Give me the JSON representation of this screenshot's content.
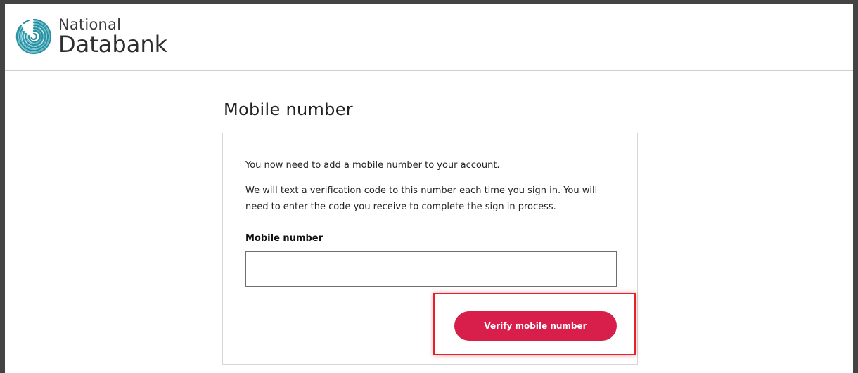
{
  "brand": {
    "line1": "National",
    "line2": "Databank",
    "logo_icon": "fingerprint-icon"
  },
  "page": {
    "title": "Mobile number"
  },
  "card": {
    "intro": "You now need to add a mobile number to your account.",
    "details": "We will text a verification code to this number each time you sign in. You will need to enter the code you receive to complete the sign in process.",
    "field_label": "Mobile number",
    "field_value": "",
    "field_placeholder": "",
    "button_label": "Verify mobile number"
  },
  "colors": {
    "frame": "#434343",
    "brand_teal": "#2a8fa0",
    "button": "#d81e4a",
    "highlight": "#e8202a"
  }
}
